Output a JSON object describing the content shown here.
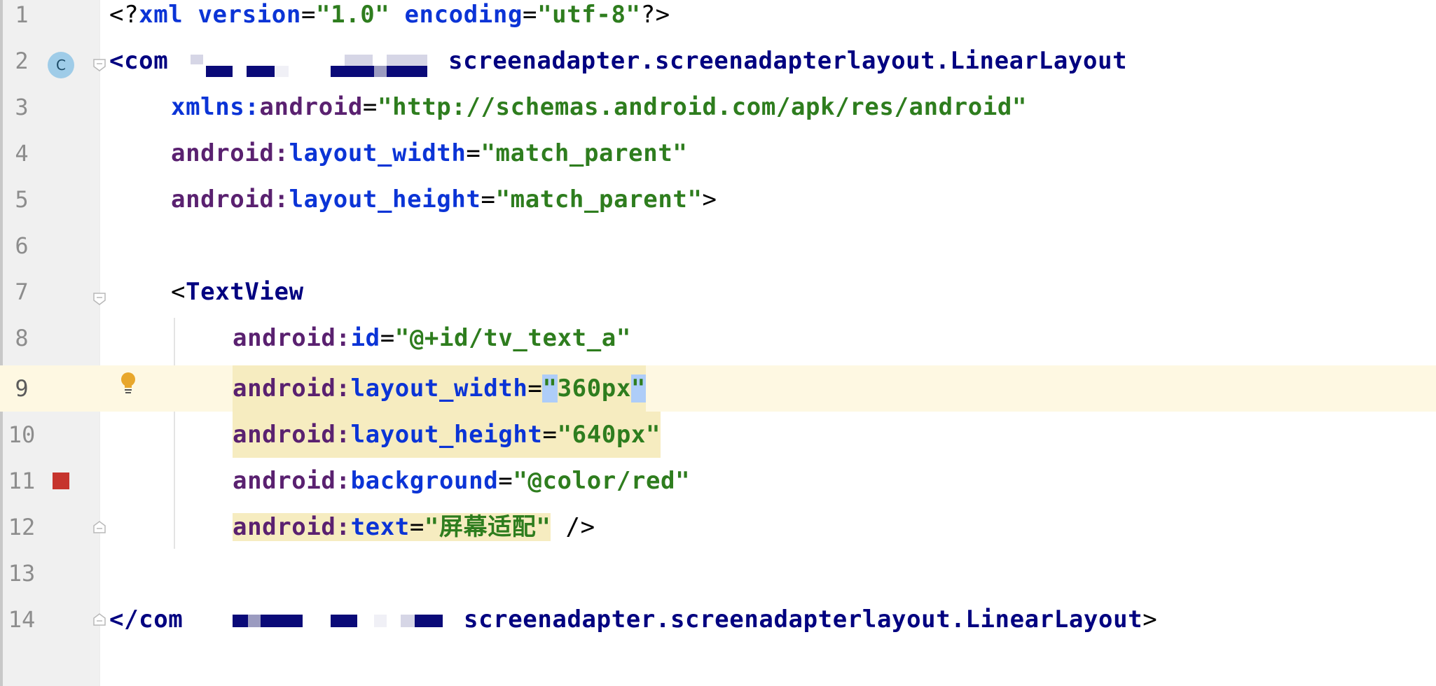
{
  "editor": {
    "lines": [
      {
        "num": "1"
      },
      {
        "num": "2"
      },
      {
        "num": "3"
      },
      {
        "num": "4"
      },
      {
        "num": "5"
      },
      {
        "num": "6"
      },
      {
        "num": "7"
      },
      {
        "num": "8"
      },
      {
        "num": "9"
      },
      {
        "num": "10"
      },
      {
        "num": "11"
      },
      {
        "num": "12"
      },
      {
        "num": "13"
      },
      {
        "num": "14"
      }
    ],
    "l1": {
      "open": "<?",
      "xml": "xml",
      "version_attr": "version",
      "eq": "=",
      "version_val": "\"1.0\"",
      "encoding_attr": "encoding",
      "encoding_val": "\"utf-8\"",
      "close": "?>"
    },
    "l2": {
      "open": "<com",
      "rest": "screenadapter.screenadapterlayout.LinearLayout"
    },
    "l3": {
      "ns": "xmlns:",
      "attr": "android",
      "eq": "=",
      "val": "\"http://schemas.android.com/apk/res/android\""
    },
    "l4": {
      "ns": "android:",
      "attr": "layout_width",
      "eq": "=",
      "val": "\"match_parent\""
    },
    "l5": {
      "ns": "android:",
      "attr": "layout_height",
      "eq": "=",
      "val": "\"match_parent\"",
      "close": ">"
    },
    "l7": {
      "open": "<",
      "tag": "TextView"
    },
    "l8": {
      "ns": "android:",
      "attr": "id",
      "eq": "=",
      "val": "\"@+id/tv_text_a\""
    },
    "l9": {
      "ns": "android:",
      "attr": "layout_width",
      "eq": "=",
      "q1": "\"",
      "val": "360px",
      "q2": "\""
    },
    "l10": {
      "ns": "android:",
      "attr": "layout_height",
      "eq": "=",
      "val": "\"640px\""
    },
    "l11": {
      "ns": "android:",
      "attr": "background",
      "eq": "=",
      "val": "\"@color/red\""
    },
    "l12": {
      "ns": "android:",
      "attr": "text",
      "eq": "=",
      "val": "\"屏幕适配\"",
      "close": " />"
    },
    "l14": {
      "open": "</com",
      "rest": "screenadapter.screenadapterlayout.LinearLayout",
      "close": ">"
    }
  },
  "gutter_icons": {
    "class_icon_letter": "C",
    "class_icon_color": "#9fcce8",
    "bulb_color": "#e8a72c",
    "color_swatch": "#c6342d"
  },
  "colors": {
    "current_line": "#fef8e2",
    "selection": "#aecdf8",
    "warning_highlight": "#f6ecc0"
  }
}
